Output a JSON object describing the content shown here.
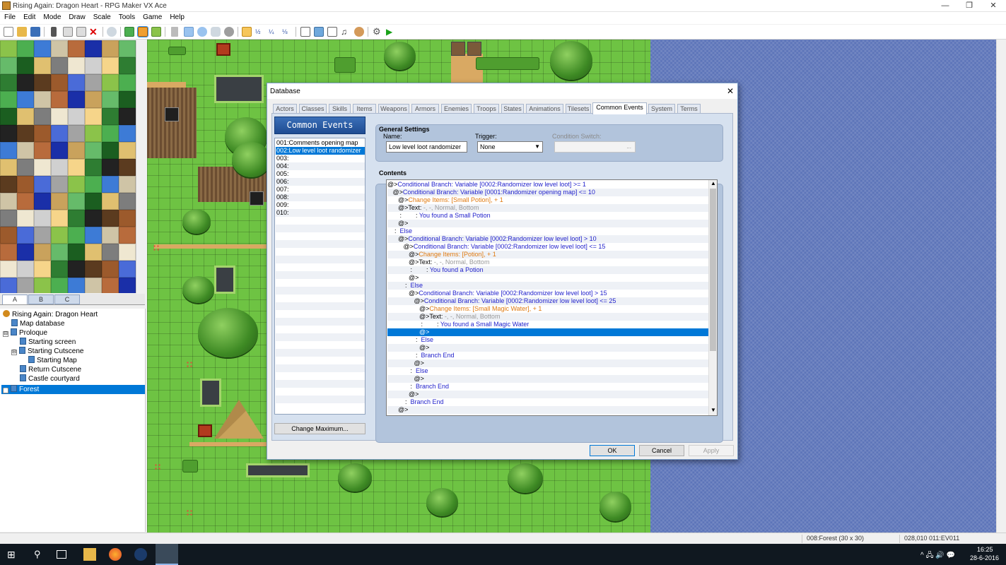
{
  "window": {
    "title": "Rising Again: Dragon Heart - RPG Maker VX Ace",
    "controls": [
      "—",
      "❐",
      "✕"
    ]
  },
  "menu": [
    "File",
    "Edit",
    "Mode",
    "Draw",
    "Scale",
    "Tools",
    "Game",
    "Help"
  ],
  "toolbar_icons": [
    "new-project-icon",
    "open-project-icon",
    "save-project-icon",
    "cut-icon",
    "copy-icon",
    "paste-icon",
    "delete-icon",
    "undo-icon",
    "map-layer-icon",
    "event-layer-icon",
    "region-icon",
    "pencil-icon",
    "rectangle-icon",
    "ellipse-icon",
    "fill-icon",
    "shadow-pen-icon",
    "zoom-1-1-icon",
    "zoom-1-2-icon",
    "zoom-1-4-icon",
    "zoom-1-8-icon",
    "database-icon",
    "resource-manager-icon",
    "script-editor-icon",
    "sound-test-icon",
    "character-generator-icon",
    "options-icon",
    "playtest-icon"
  ],
  "palette": {
    "tabs": [
      "A",
      "B",
      "C"
    ],
    "active_tab": "A"
  },
  "map_tree": {
    "project": "Rising Again: Dragon Heart",
    "items": [
      {
        "label": "Map database",
        "depth": 1
      },
      {
        "label": "Proloque",
        "depth": 1,
        "expander": "⊟"
      },
      {
        "label": "Starting screen",
        "depth": 2
      },
      {
        "label": "Starting Cutscene",
        "depth": 2,
        "expander": "⊟"
      },
      {
        "label": "Starting Map",
        "depth": 3
      },
      {
        "label": "Return Cutscene",
        "depth": 2
      },
      {
        "label": "Castle courtyard",
        "depth": 2
      },
      {
        "label": "Forest",
        "depth": 1,
        "expander": "⊞",
        "selected": true
      }
    ]
  },
  "status": {
    "map": "008:Forest (30 x 30)",
    "coords": "028,010",
    "event": "011:EV011"
  },
  "taskbar": {
    "time": "16:25",
    "date": "28-6-2016",
    "tray": "^ 🖧 🔊 💬"
  },
  "dialog": {
    "title": "Database",
    "close": "✕",
    "tabs": [
      "Actors",
      "Classes",
      "Skills",
      "Items",
      "Weapons",
      "Armors",
      "Enemies",
      "Troops",
      "States",
      "Animations",
      "Tilesets",
      "Common Events",
      "System",
      "Terms"
    ],
    "active_tab": "Common Events",
    "list_header": "Common Events",
    "events": [
      "001:Comments opening map",
      "002:Low level loot randomizer",
      "003:",
      "004:",
      "005:",
      "006:",
      "007:",
      "008:",
      "009:",
      "010:"
    ],
    "selected_event_index": 1,
    "change_maximum": "Change Maximum...",
    "general_settings": {
      "heading": "General Settings",
      "name_label": "Name:",
      "name_value": "Low level loot randomizer",
      "trigger_label": "Trigger:",
      "trigger_value": "None",
      "condition_label": "Condition Switch:",
      "condition_value": "..."
    },
    "contents_heading": "Contents",
    "commands": [
      {
        "indent": "",
        "prefix": "@>",
        "text": "Conditional Branch: Variable [0002:Randomizer low level loot] >= 1",
        "color": "blue"
      },
      {
        "indent": "   ",
        "prefix": "@>",
        "text": "Conditional Branch: Variable [0001:Randomizer opening map] <= 10",
        "color": "blue"
      },
      {
        "indent": "      ",
        "prefix": "@>",
        "text": "Change Items: [Small Potion], + 1",
        "color": "orange"
      },
      {
        "indent": "      ",
        "prefix": "@>Text: ",
        "text": "-, -, Normal, Bottom",
        "color": "gray"
      },
      {
        "indent": "      ",
        "prefix": " :        : ",
        "text": "You found a Small Potion",
        "color": "blue"
      },
      {
        "indent": "      ",
        "prefix": "@>",
        "text": "",
        "color": "black"
      },
      {
        "indent": "   ",
        "prefix": " :  ",
        "text": "Else",
        "color": "blue"
      },
      {
        "indent": "      ",
        "prefix": "@>",
        "text": "Conditional Branch: Variable [0002:Randomizer low level loot] > 10",
        "color": "blue"
      },
      {
        "indent": "         ",
        "prefix": "@>",
        "text": "Conditional Branch: Variable [0002:Randomizer low level loot] <= 15",
        "color": "blue"
      },
      {
        "indent": "            ",
        "prefix": "@>",
        "text": "Change Items: [Potion], + 1",
        "color": "orange"
      },
      {
        "indent": "            ",
        "prefix": "@>Text: ",
        "text": "-, -, Normal, Bottom",
        "color": "gray"
      },
      {
        "indent": "            ",
        "prefix": " :        : ",
        "text": "You found a Potion",
        "color": "blue"
      },
      {
        "indent": "            ",
        "prefix": "@>",
        "text": "",
        "color": "black"
      },
      {
        "indent": "         ",
        "prefix": " :  ",
        "text": "Else",
        "color": "blue"
      },
      {
        "indent": "            ",
        "prefix": "@>",
        "text": "Conditional Branch: Variable [0002:Randomizer low level loot] > 15",
        "color": "blue"
      },
      {
        "indent": "               ",
        "prefix": "@>",
        "text": "Conditional Branch: Variable [0002:Randomizer low level loot] <= 25",
        "color": "blue"
      },
      {
        "indent": "                  ",
        "prefix": "@>",
        "text": "Change Items: [Small Magic Water], + 1",
        "color": "orange"
      },
      {
        "indent": "                  ",
        "prefix": "@>Text: ",
        "text": "-, -, Normal, Bottom",
        "color": "gray"
      },
      {
        "indent": "                  ",
        "prefix": " :        : ",
        "text": "You found a Small Magic Water",
        "color": "blue"
      },
      {
        "indent": "                  ",
        "prefix": "@>",
        "text": "",
        "color": "black",
        "selected": true
      },
      {
        "indent": "               ",
        "prefix": " :  ",
        "text": "Else",
        "color": "blue"
      },
      {
        "indent": "                  ",
        "prefix": "@>",
        "text": "",
        "color": "black"
      },
      {
        "indent": "               ",
        "prefix": " :  ",
        "text": "Branch End",
        "color": "blue"
      },
      {
        "indent": "               ",
        "prefix": "@>",
        "text": "",
        "color": "black"
      },
      {
        "indent": "            ",
        "prefix": " :  ",
        "text": "Else",
        "color": "blue"
      },
      {
        "indent": "               ",
        "prefix": "@>",
        "text": "",
        "color": "black"
      },
      {
        "indent": "            ",
        "prefix": " :  ",
        "text": "Branch End",
        "color": "blue"
      },
      {
        "indent": "            ",
        "prefix": "@>",
        "text": "",
        "color": "black"
      },
      {
        "indent": "         ",
        "prefix": " :  ",
        "text": "Branch End",
        "color": "blue"
      },
      {
        "indent": "      ",
        "prefix": "@>",
        "text": "",
        "color": "black"
      }
    ],
    "buttons": {
      "ok": "OK",
      "cancel": "Cancel",
      "apply": "Apply"
    }
  }
}
